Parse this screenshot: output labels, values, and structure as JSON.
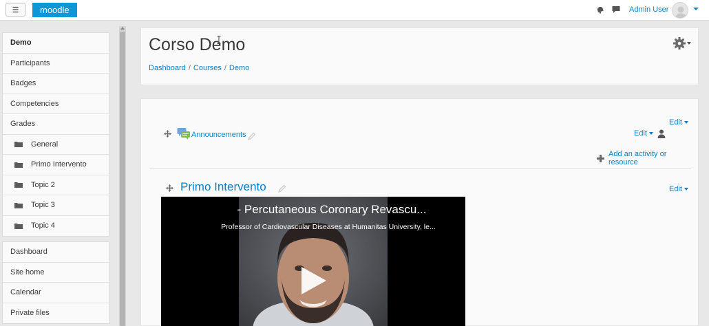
{
  "navbar": {
    "menu_toggle_glyph": "☰",
    "brand": "moodle",
    "user_name": "Admin User",
    "icons": [
      "notifications-icon",
      "messages-icon",
      "avatar",
      "user-menu-caret-icon"
    ]
  },
  "drawer": {
    "course_nav": [
      {
        "label": "Demo",
        "active": true
      },
      {
        "label": "Participants"
      },
      {
        "label": "Badges"
      },
      {
        "label": "Competencies"
      },
      {
        "label": "Grades"
      },
      {
        "label": "General",
        "icon": "folder-icon"
      },
      {
        "label": "Primo Intervento",
        "icon": "folder-icon"
      },
      {
        "label": "Topic 2",
        "icon": "folder-icon"
      },
      {
        "label": "Topic 3",
        "icon": "folder-icon"
      },
      {
        "label": "Topic 4",
        "icon": "folder-icon"
      }
    ],
    "site_nav": [
      {
        "label": "Dashboard"
      },
      {
        "label": "Site home"
      },
      {
        "label": "Calendar"
      },
      {
        "label": "Private files"
      }
    ]
  },
  "header": {
    "course_title": "Corso Demo",
    "breadcrumb": [
      "Dashboard",
      "Courses",
      "Demo"
    ],
    "breadcrumb_separator": "/"
  },
  "main": {
    "section0": {
      "edit_label": "Edit",
      "activity": {
        "label": "Announcements",
        "edit_label": "Edit"
      },
      "add_activity_label": "Add an activity or resource"
    },
    "section1": {
      "title": "Primo Intervento",
      "edit_label": "Edit",
      "video": {
        "title": "- Percutaneous Coronary Revascu...",
        "subtitle": "Professor of Cardiovascular Diseases at Humanitas University, le..."
      }
    }
  },
  "colors": {
    "brand": "#0f96d6",
    "link": "#0f7ec2",
    "page_bg": "#e8e8e8",
    "card_bg": "#fafafa"
  }
}
